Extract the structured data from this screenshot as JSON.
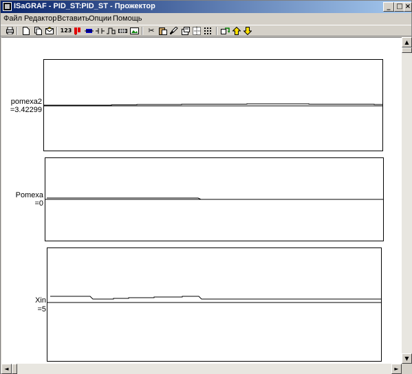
{
  "window": {
    "title": "ISaGRAF - PID_ST:PID_ST - Прожектор",
    "controls": {
      "minimize": "_",
      "maximize": "□",
      "close": "×"
    }
  },
  "menu": [
    "Файл",
    "Редактор",
    "Вставить",
    "Опции",
    "Помощь"
  ],
  "toolbar": {
    "icons": [
      "print-icon",
      "new-icon",
      "copy-doc-icon",
      "mail-icon",
      "number-icon",
      "red-tool-icon",
      "blue-tool-icon",
      "contact-icon",
      "pulse-icon",
      "block-icon",
      "image-icon",
      "cut-icon",
      "paste-icon",
      "brush-icon",
      "properties-icon",
      "grid-icon",
      "dots-grid-icon",
      "refresh-icon",
      "up-arrow-icon",
      "down-arrow-icon"
    ],
    "number_label": "123"
  },
  "plots": [
    {
      "name": "pomexa2",
      "value": "=3.42299"
    },
    {
      "name": "Pomexa",
      "value": "=0"
    },
    {
      "name": "Xin",
      "value": "=5"
    }
  ],
  "scrollbars": {
    "up": "▲",
    "down": "▼",
    "left": "◄",
    "right": "►"
  }
}
